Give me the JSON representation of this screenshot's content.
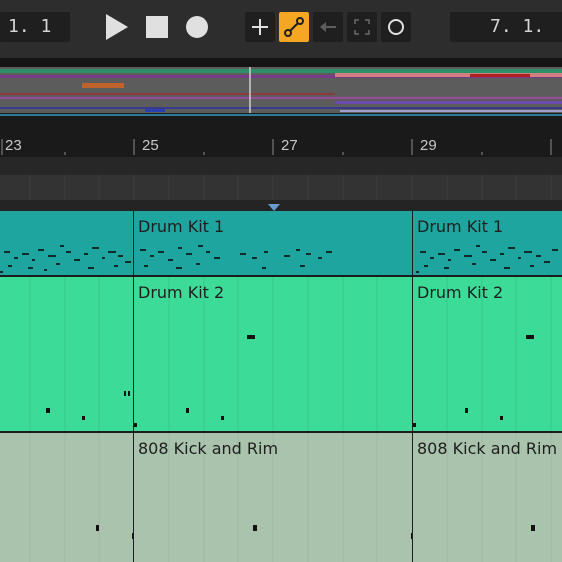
{
  "transport": {
    "position": "1. 1",
    "end_position": "7. 1.",
    "play_icon": "play-icon",
    "stop_icon": "stop-icon",
    "record_icon": "record-icon",
    "accent_color": "#f5a623"
  },
  "ruler": {
    "bars": [
      "23",
      "25",
      "27",
      "29"
    ]
  },
  "clips": {
    "drum_kit_1": {
      "name": "Drum Kit 1",
      "color": "#1ea59f"
    },
    "drum_kit_2": {
      "name": "Drum Kit 2",
      "color": "#3ddb98"
    },
    "kick_rim": {
      "name": "808 Kick and Rim",
      "color": "#a9c3ad"
    }
  }
}
